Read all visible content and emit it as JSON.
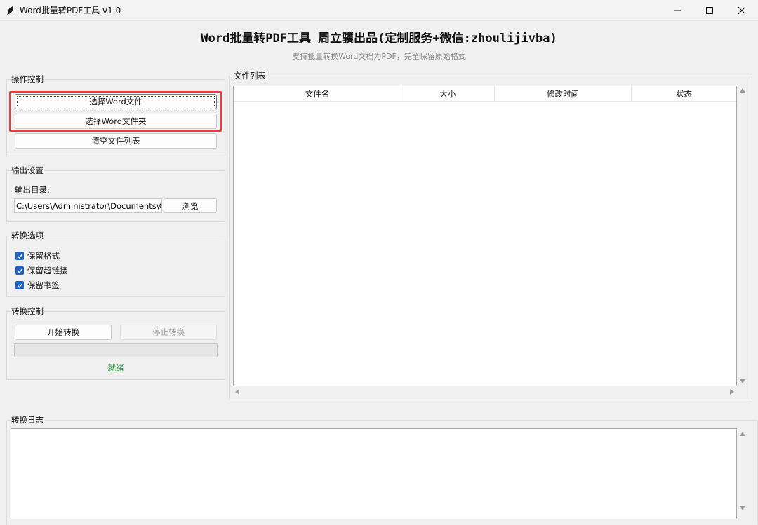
{
  "window": {
    "title": "Word批量转PDF工具 v1.0",
    "icon": "feather-icon"
  },
  "header": {
    "title": "Word批量转PDF工具 周立骥出品(定制服务+微信:zhoulijivba)",
    "subtitle": "支持批量转换Word文档为PDF，完全保留原始格式"
  },
  "operation": {
    "group_label": "操作控制",
    "select_files_label": "选择Word文件",
    "select_folder_label": "选择Word文件夹",
    "clear_list_label": "清空文件列表"
  },
  "output": {
    "group_label": "输出设置",
    "dir_label": "输出目录:",
    "dir_value": "C:\\Users\\Administrator\\Documents\\Cor",
    "browse_label": "浏览"
  },
  "options": {
    "group_label": "转换选项",
    "items": [
      {
        "label": "保留格式",
        "checked": true
      },
      {
        "label": "保留超链接",
        "checked": true
      },
      {
        "label": "保留书签",
        "checked": true
      }
    ]
  },
  "control": {
    "group_label": "转换控制",
    "start_label": "开始转换",
    "stop_label": "停止转换",
    "progress": 0,
    "status": "就绪"
  },
  "file_list": {
    "group_label": "文件列表",
    "columns": [
      "文件名",
      "大小",
      "修改时间",
      "状态"
    ],
    "rows": []
  },
  "log": {
    "group_label": "转换日志",
    "content": ""
  },
  "colors": {
    "highlight": "#ee3a3a",
    "checkbox": "#1e63c4",
    "status": "#1f9c2e"
  }
}
